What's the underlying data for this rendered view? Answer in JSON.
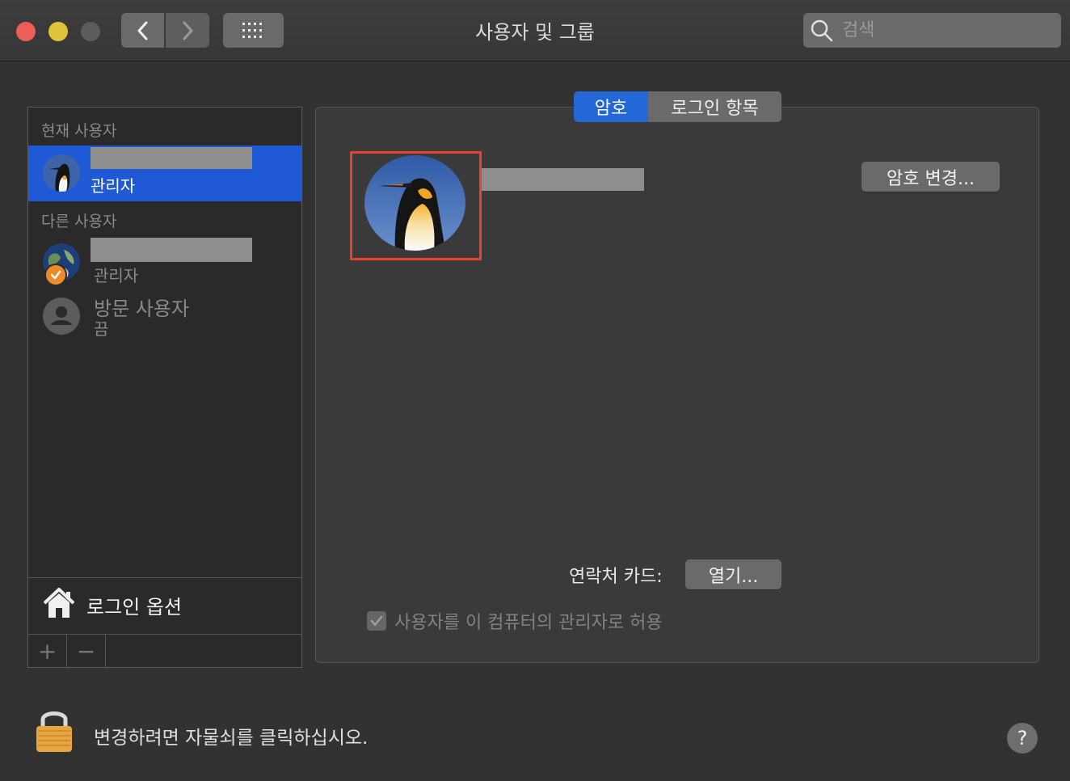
{
  "window": {
    "title": "사용자 및 그룹",
    "search_placeholder": "검색"
  },
  "sidebar": {
    "current_header": "현재 사용자",
    "current_user": {
      "role": "관리자"
    },
    "other_header": "다른 사용자",
    "other_users": [
      {
        "role": "관리자"
      },
      {
        "name": "방문 사용자",
        "status": "끔"
      }
    ],
    "login_options": "로그인 옵션",
    "add_symbol": "+",
    "remove_symbol": "−"
  },
  "tabs": [
    {
      "label": "암호",
      "selected": true
    },
    {
      "label": "로그인 항목",
      "selected": false
    }
  ],
  "main": {
    "change_password_button": "암호 변경...",
    "contact_card_label": "연락처 카드:",
    "open_button": "열기...",
    "allow_admin_label": "사용자를 이 컴퓨터의 관리자로 허용",
    "allow_admin_checked": true
  },
  "footer": {
    "lock_text": "변경하려면 자물쇠를 클릭하십시오.",
    "help_symbol": "?"
  },
  "colors": {
    "accent": "#2467d6",
    "highlight_frame": "#e8412d"
  }
}
